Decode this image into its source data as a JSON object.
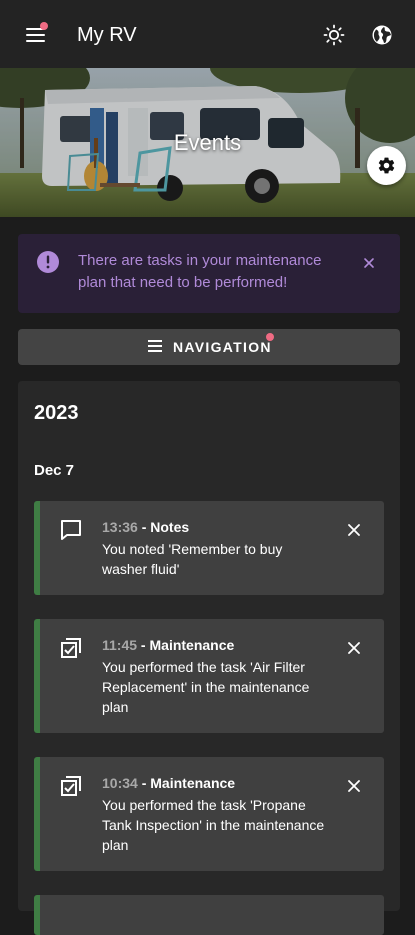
{
  "app": {
    "title": "My RV",
    "menu_icon": "hamburger-menu-icon",
    "theme_icon": "brightness-icon",
    "language_icon": "globe-icon"
  },
  "banner": {
    "title": "Events",
    "settings_icon": "gear-icon"
  },
  "alert": {
    "icon": "exclamation-circle-icon",
    "text": "There are tasks in your maintenance plan that need to be performed!",
    "close_icon": "close-icon",
    "color": "#b08ad8"
  },
  "navigation": {
    "label": "NAVIGATION",
    "icon": "menu-lines-icon",
    "badge_color": "#ef6b83"
  },
  "events": {
    "year": "2023",
    "date": "Dec 7",
    "accent": "#3f7d44",
    "items": [
      {
        "time": "13:36",
        "separator": " - ",
        "category": "Notes",
        "text": "You noted 'Remember to buy washer fluid'",
        "icon": "comment-icon"
      },
      {
        "time": "11:45",
        "separator": " - ",
        "category": "Maintenance",
        "text": "You performed the task 'Air Filter Replacement' in the maintenance plan",
        "icon": "checklist-icon"
      },
      {
        "time": "10:34",
        "separator": " - ",
        "category": "Maintenance",
        "text": "You performed the task 'Propane Tank Inspection' in the maintenance plan",
        "icon": "checklist-icon"
      }
    ]
  }
}
